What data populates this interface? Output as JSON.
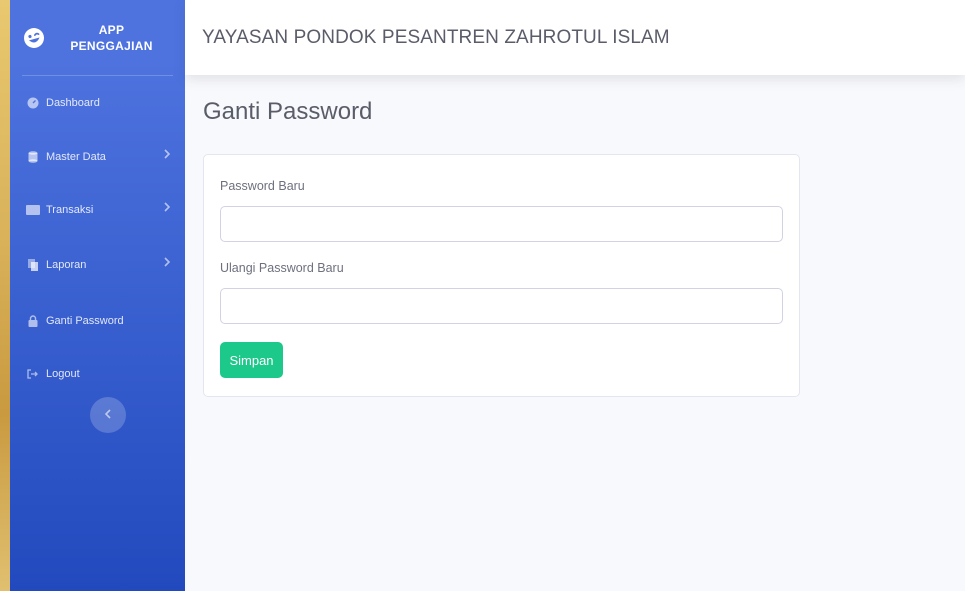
{
  "brand": {
    "line1": "APP",
    "line2": "PENGGAJIAN",
    "icon": "laugh-wink-icon"
  },
  "sidebar": {
    "items": [
      {
        "label": "Dashboard",
        "icon": "tachometer-icon"
      },
      {
        "label": "Master Data",
        "icon": "database-icon",
        "has_submenu": true
      },
      {
        "label": "Transaksi",
        "icon": "money-icon",
        "has_submenu": true
      },
      {
        "label": "Laporan",
        "icon": "copy-icon",
        "has_submenu": true
      },
      {
        "label": "Ganti Password",
        "icon": "lock-icon"
      },
      {
        "label": "Logout",
        "icon": "sign-out-icon"
      }
    ],
    "toggle_icon": "chevron-left-icon"
  },
  "topbar": {
    "title": "YAYASAN PONDOK PESANTREN ZAHROTUL ISLAM"
  },
  "main": {
    "page_title": "Ganti Password",
    "form": {
      "new_password_label": "Password Baru",
      "new_password_value": "",
      "repeat_password_label": "Ulangi Password Baru",
      "repeat_password_value": "",
      "submit_label": "Simpan"
    }
  },
  "colors": {
    "sidebar_top": "#4e73df",
    "sidebar_bottom": "#224abe",
    "success": "#1cc88a",
    "text": "#5a5c69",
    "background": "#f8f9fc"
  }
}
